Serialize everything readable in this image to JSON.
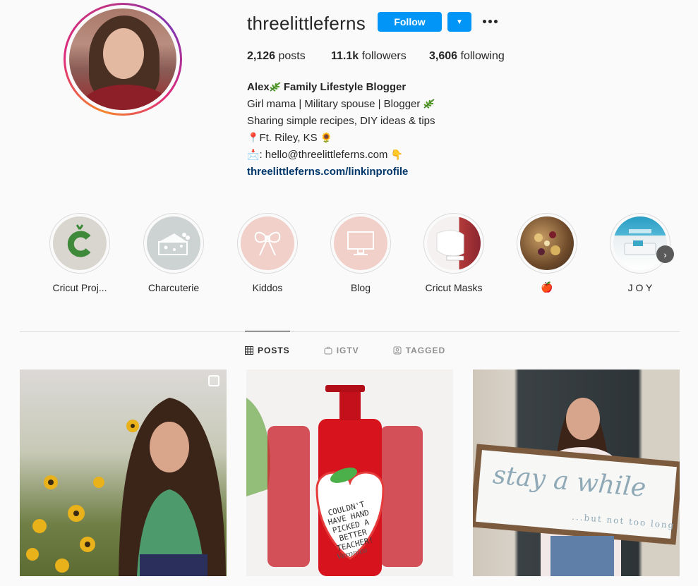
{
  "profile": {
    "username": "threelittleferns",
    "follow_label": "Follow",
    "dropdown_glyph": "▼",
    "stats": {
      "posts_count": "2,126",
      "posts_label": " posts",
      "followers_count": "11.1k",
      "followers_label": " followers",
      "following_count": "3,606",
      "following_label": " following"
    },
    "bio": {
      "name_pre": "Alex",
      "name_post": " Family Lifestyle Blogger",
      "line1": "Girl mama | Military spouse | Blogger ",
      "line2": "Sharing simple recipes, DIY ideas & tips",
      "line3_emoji": "📍",
      "line3": "Ft. Riley, KS ",
      "line3_end_emoji": "🌻",
      "line4_emoji": "📩",
      "line4": ": hello@threelittleferns.com ",
      "line4_end_emoji": "👇",
      "link": "threelittleferns.com/linkinprofile"
    }
  },
  "highlights": [
    {
      "label": "Cricut Proj...",
      "icon": "cricut-c-logo"
    },
    {
      "label": "Charcuterie",
      "icon": "cheese-icon"
    },
    {
      "label": "Kiddos",
      "icon": "bow-icon"
    },
    {
      "label": "Blog",
      "icon": "computer-icon"
    },
    {
      "label": "Cricut Masks",
      "icon": "mask-photo"
    },
    {
      "label": "🍎",
      "icon": "charcuterie-board-photo"
    },
    {
      "label": "J O Y",
      "icon": "cricut-machine-photo"
    }
  ],
  "tabs": [
    {
      "label": "POSTS",
      "icon": "grid-icon",
      "active": true
    },
    {
      "label": "IGTV",
      "icon": "igtv-icon",
      "active": false
    },
    {
      "label": "TAGGED",
      "icon": "tagged-icon",
      "active": false
    }
  ],
  "posts": {
    "post2_tag_text": "COULDN'T HAVE HAND PICKED A BETTER TEACHER!",
    "post2_signature": "Veronica",
    "post3_sign_main": "stay a while",
    "post3_sign_sub": "...but not too long"
  },
  "colors": {
    "accent": "#0095f6",
    "link": "#00376b",
    "background": "#fafafa",
    "highlight_pink": "#f2d0ca",
    "highlight_gray": "#cdd3d2"
  }
}
